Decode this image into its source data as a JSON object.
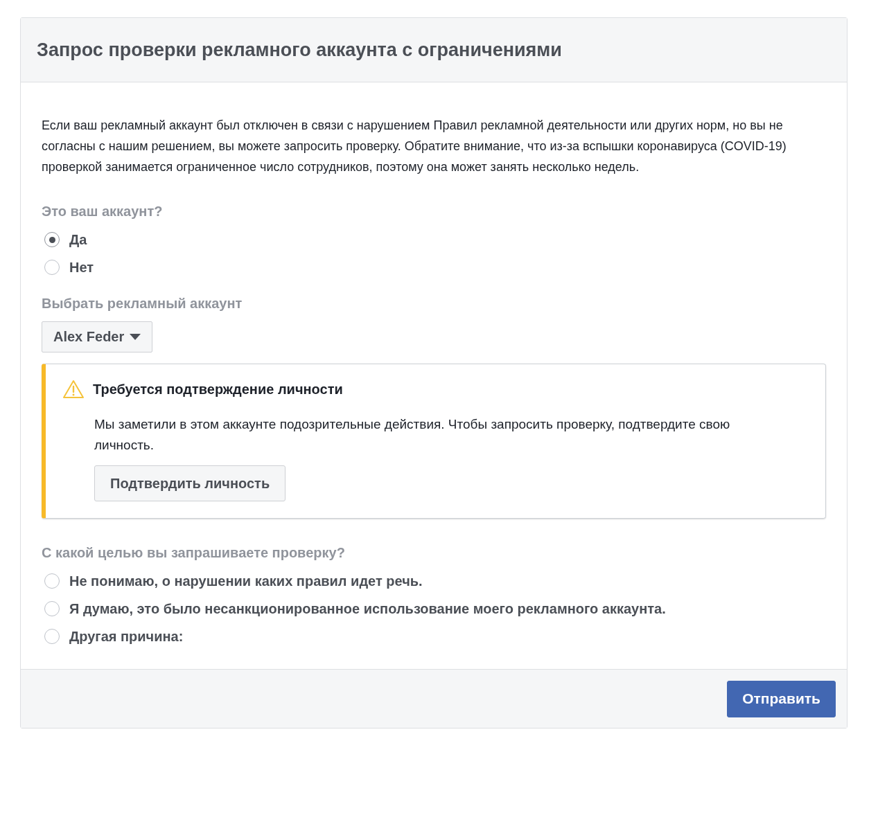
{
  "dialog": {
    "title": "Запрос проверки рекламного аккаунта с ограничениями"
  },
  "intro": "Если ваш рекламный аккаунт был отключен в связи с нарушением Правил рекламной деятельности или других норм, но вы не согласны с нашим решением, вы можете запросить проверку. Обратите внимание, что из-за вспышки коронавируса (COVID-19) проверкой занимается ограниченное число сотрудников, поэтому она может занять несколько недель.",
  "ownership": {
    "label": "Это ваш аккаунт?",
    "options": [
      {
        "label": "Да",
        "selected": true
      },
      {
        "label": "Нет",
        "selected": false
      }
    ]
  },
  "account_select": {
    "label": "Выбрать рекламный аккаунт",
    "value": "Alex Feder"
  },
  "warning": {
    "title": "Требуется подтверждение личности",
    "text": "Мы заметили в этом аккаунте подозрительные действия. Чтобы запросить проверку, подтвердите свою личность.",
    "button": "Подтвердить личность"
  },
  "reason": {
    "label": "С какой целью вы запрашиваете проверку?",
    "options": [
      {
        "label": "Не понимаю, о нарушении каких правил идет речь.",
        "selected": false
      },
      {
        "label": "Я думаю, это было несанкционированное использование моего рекламного аккаунта.",
        "selected": false
      },
      {
        "label": "Другая причина:",
        "selected": false
      }
    ]
  },
  "footer": {
    "submit": "Отправить"
  }
}
